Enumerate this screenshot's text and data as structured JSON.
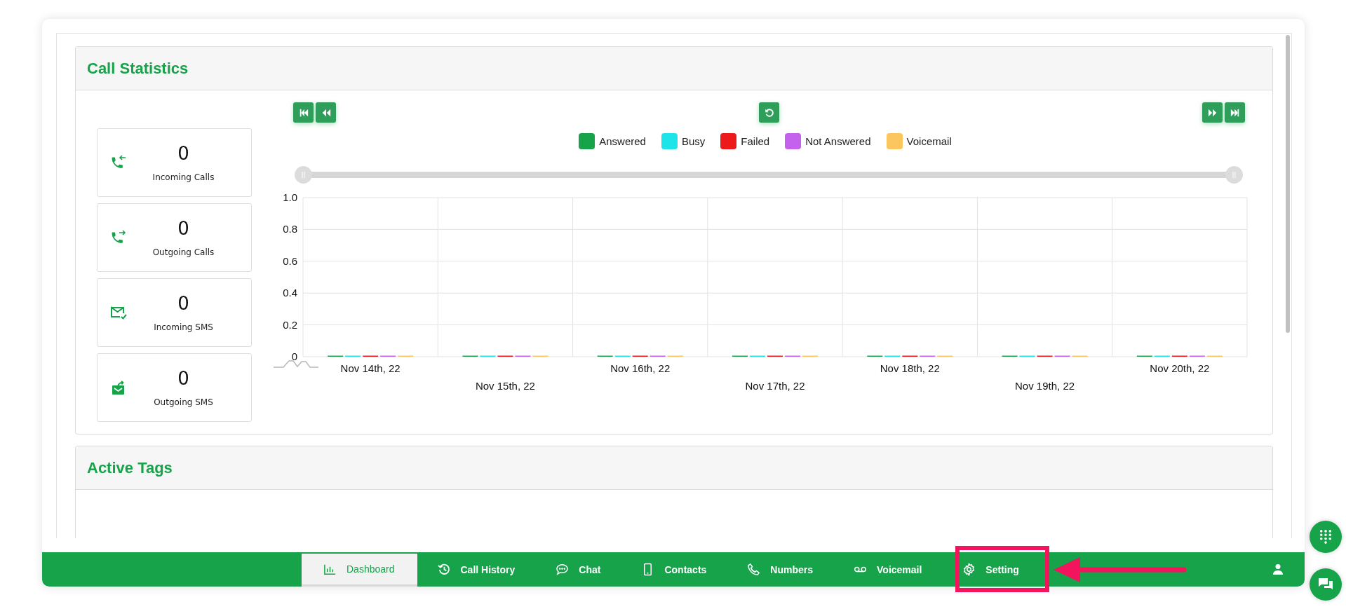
{
  "call_statistics": {
    "title": "Call Statistics",
    "stats": [
      {
        "kind": "incoming_call",
        "value": "0",
        "label": "Incoming Calls"
      },
      {
        "kind": "outgoing_call",
        "value": "0",
        "label": "Outgoing Calls"
      },
      {
        "kind": "incoming_sms",
        "value": "0",
        "label": "Incoming SMS"
      },
      {
        "kind": "outgoing_sms",
        "value": "0",
        "label": "Outgoing SMS"
      }
    ],
    "chart_data": {
      "type": "bar",
      "categories": [
        "Nov 14th, 22",
        "Nov 15th, 22",
        "Nov 16th, 22",
        "Nov 17th, 22",
        "Nov 18th, 22",
        "Nov 19th, 22",
        "Nov 20th, 22"
      ],
      "series": [
        {
          "name": "Answered",
          "color": "#16a34a",
          "values": [
            0,
            0,
            0,
            0,
            0,
            0,
            0
          ]
        },
        {
          "name": "Busy",
          "color": "#1de4e8",
          "values": [
            0,
            0,
            0,
            0,
            0,
            0,
            0
          ]
        },
        {
          "name": "Failed",
          "color": "#ec1a1a",
          "values": [
            0,
            0,
            0,
            0,
            0,
            0,
            0
          ]
        },
        {
          "name": "Not Answered",
          "color": "#c462ee",
          "values": [
            0,
            0,
            0,
            0,
            0,
            0,
            0
          ]
        },
        {
          "name": "Voicemail",
          "color": "#fcc65e",
          "values": [
            0,
            0,
            0,
            0,
            0,
            0,
            0
          ]
        }
      ],
      "grid": true,
      "ylim": [
        0,
        1
      ],
      "yticks": [
        0,
        0.2,
        0.4,
        0.6,
        0.8,
        {
          "value": 1,
          "label": "1.0"
        }
      ]
    }
  },
  "active_tags": {
    "title": "Active Tags"
  },
  "bottom_nav": [
    {
      "kind": "chart",
      "label": "Dashboard",
      "selected": true
    },
    {
      "kind": "history",
      "label": "Call History",
      "selected": false
    },
    {
      "kind": "chat",
      "label": "Chat",
      "selected": false
    },
    {
      "kind": "phone_device",
      "label": "Contacts",
      "selected": false
    },
    {
      "kind": "phone",
      "label": "Numbers",
      "selected": false
    },
    {
      "kind": "voicemail",
      "label": "Voicemail",
      "selected": false
    },
    {
      "kind": "gear",
      "label": "Setting",
      "selected": false
    }
  ]
}
